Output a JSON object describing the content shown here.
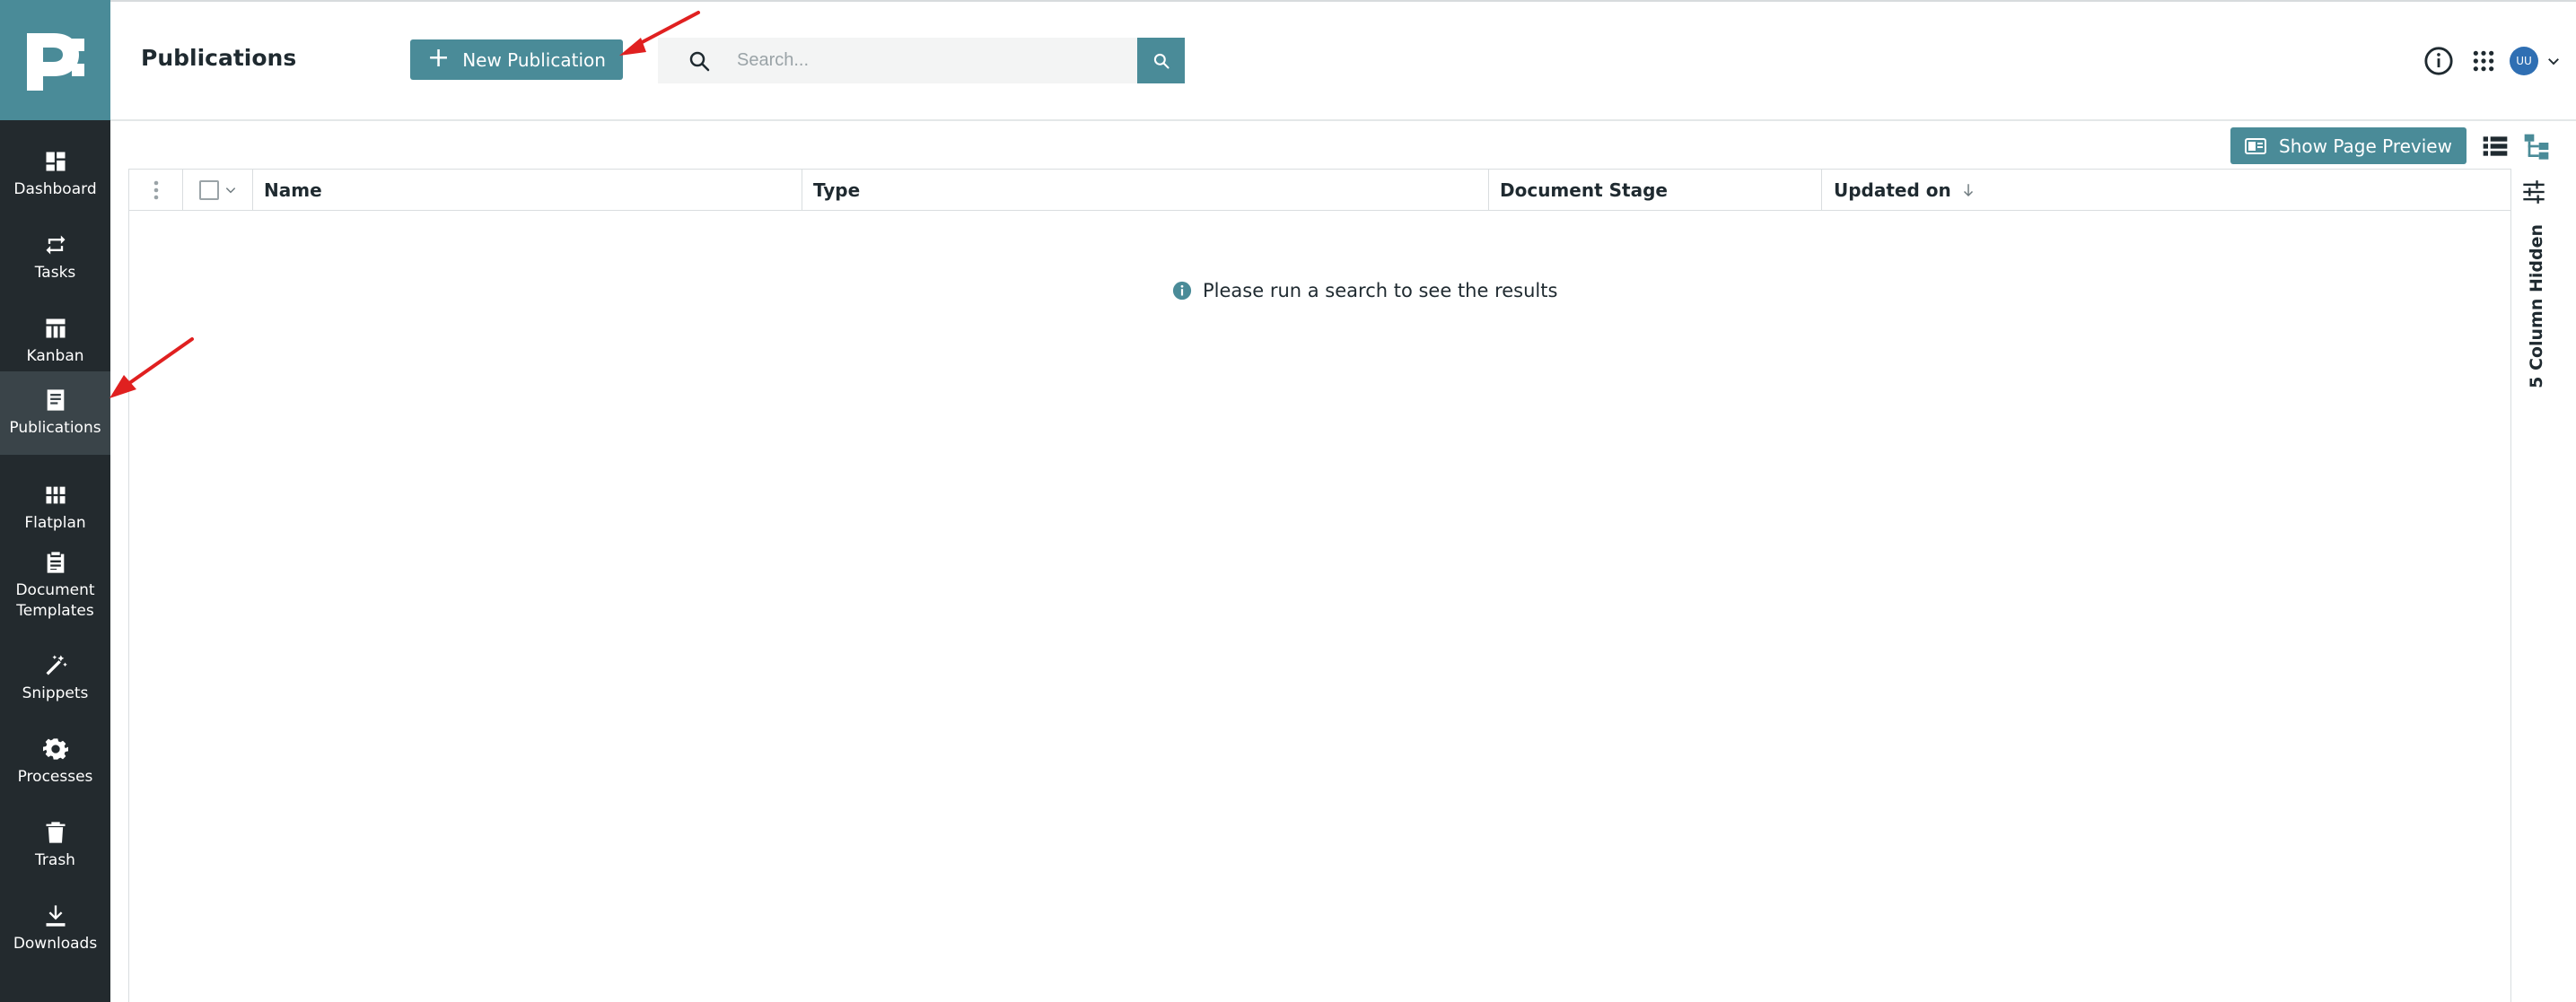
{
  "app": {
    "logo_text": "p:",
    "brand_color": "#4a8b98",
    "sidebar_color": "#232a2e"
  },
  "sidebar": {
    "items": [
      {
        "label": "Dashboard",
        "icon": "dashboard-icon"
      },
      {
        "label": "Tasks",
        "icon": "swap-arrows-icon"
      },
      {
        "label": "Kanban",
        "icon": "kanban-board-icon"
      },
      {
        "label": "Publications",
        "icon": "document-icon",
        "active": true
      },
      {
        "label": "Flatplan",
        "icon": "grid-icon"
      },
      {
        "label": "Document\nTemplates",
        "icon": "clipboard-icon"
      },
      {
        "label": "Snippets",
        "icon": "magic-wand-icon"
      },
      {
        "label": "Processes",
        "icon": "gear-icon"
      },
      {
        "label": "Trash",
        "icon": "trash-icon"
      },
      {
        "label": "Downloads",
        "icon": "download-icon"
      }
    ]
  },
  "header": {
    "title": "Publications",
    "new_button_label": "New Publication",
    "search_placeholder": "Search...",
    "user_initials": "UU"
  },
  "toolbar": {
    "preview_label": "Show Page Preview"
  },
  "table": {
    "columns": [
      "Name",
      "Type",
      "Document Stage",
      "Updated on"
    ],
    "sort_column": "Updated on",
    "sort_direction": "descending",
    "empty_message": "Please run a search to see the results",
    "hidden_columns_label": "5 Column Hidden"
  }
}
